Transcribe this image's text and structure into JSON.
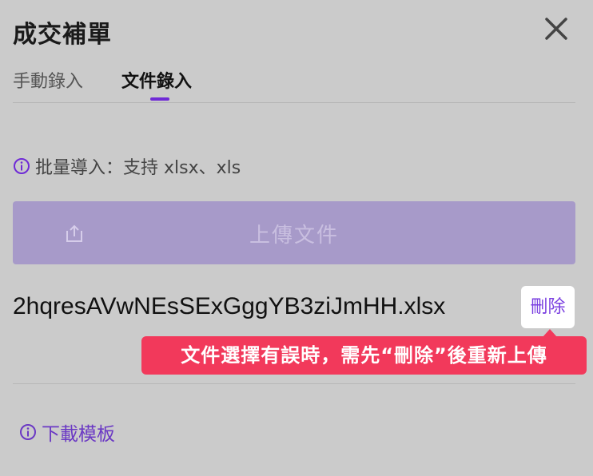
{
  "dialog": {
    "title": "成交補單"
  },
  "tabs": [
    {
      "label": "手動錄入",
      "active": false
    },
    {
      "label": "文件錄入",
      "active": true
    }
  ],
  "notice": {
    "text": "批量導入：支持 xlsx、xls",
    "icon": "info-circle-icon"
  },
  "upload": {
    "label": "上傳文件",
    "icon": "upload-icon"
  },
  "file": {
    "name": "2hqresAVwNEsSExGggYB3ziJmHH.xlsx",
    "delete_label": "刪除"
  },
  "tooltip": {
    "text": "文件選擇有誤時，需先“刪除”後重新上傳"
  },
  "download": {
    "label": "下載模板",
    "icon": "info-circle-icon"
  },
  "colors": {
    "accent": "#6f2ad6",
    "upload_bg": "#a79ac9",
    "tooltip_bg": "#f2395b",
    "overlay_bg": "#cbcbcb"
  }
}
